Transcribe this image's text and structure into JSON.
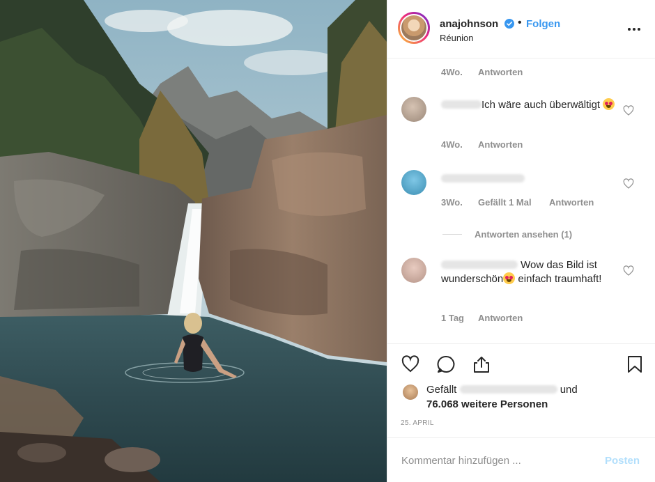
{
  "post": {
    "username": "anajohnson",
    "verified": true,
    "follow_label": "Folgen",
    "separator": "•",
    "location": "Réunion"
  },
  "comments": [
    {
      "time": "4Wo.",
      "reply_label": "Antworten"
    },
    {
      "text": "Ich wäre auch überwältigt",
      "emoji": "heart-eyes",
      "time": "4Wo.",
      "reply_label": "Antworten"
    },
    {
      "time": "3Wo.",
      "likes_label": "Gefällt 1 Mal",
      "reply_label": "Antworten",
      "view_replies": "Antworten ansehen (1)"
    },
    {
      "text_before": "Wow das Bild ist wunderschön",
      "text_after": " einfach traumhaft!",
      "emoji": "heart-eyes",
      "time": "1 Tag",
      "reply_label": "Antworten"
    }
  ],
  "likes": {
    "prefix": "Gefällt",
    "suffix": "und",
    "count_text": "76.068 weitere Personen"
  },
  "date": "25. APRIL",
  "composer": {
    "placeholder": "Kommentar hinzufügen ...",
    "post_label": "Posten"
  },
  "colors": {
    "link_blue": "#3897f0",
    "muted_gray": "#8e8e8e",
    "post_disabled": "#b2dffc",
    "text": "#262626"
  },
  "icons": [
    "verified-badge-icon",
    "more-options-icon",
    "heart-outline-icon",
    "comment-bubble-icon",
    "share-icon",
    "bookmark-icon"
  ]
}
